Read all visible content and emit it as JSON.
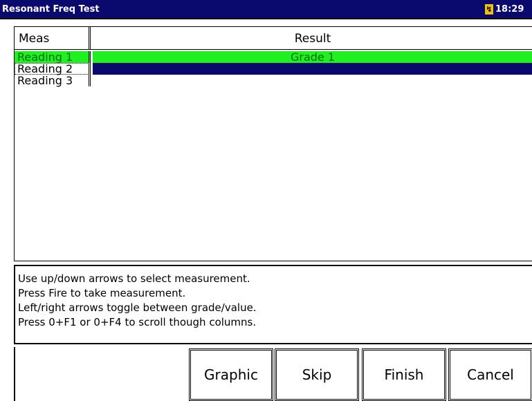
{
  "window": {
    "title": "Resonant Freq Test",
    "clock": "18:29",
    "battery_icon": "battery-charging-icon",
    "colors": {
      "titlebar": "#0a0a6e",
      "selected_row": "#20f020",
      "highlight_row": "#0a0a6e"
    }
  },
  "table": {
    "headers": {
      "meas": "Meas",
      "result": "Result"
    },
    "rows": [
      {
        "meas": "Reading 1",
        "result": "Grade 1"
      },
      {
        "meas": "Reading 2",
        "result": ""
      },
      {
        "meas": "Reading 3",
        "result": ""
      }
    ]
  },
  "help": {
    "lines": [
      "Use up/down arrows to select measurement.",
      "Press Fire to take measurement.",
      "Left/right arrows toggle between grade/value.",
      "Press 0+F1 or 0+F4 to scroll though columns."
    ]
  },
  "buttons": {
    "graphic": "Graphic",
    "skip": "Skip",
    "finish": "Finish",
    "cancel": "Cancel"
  }
}
